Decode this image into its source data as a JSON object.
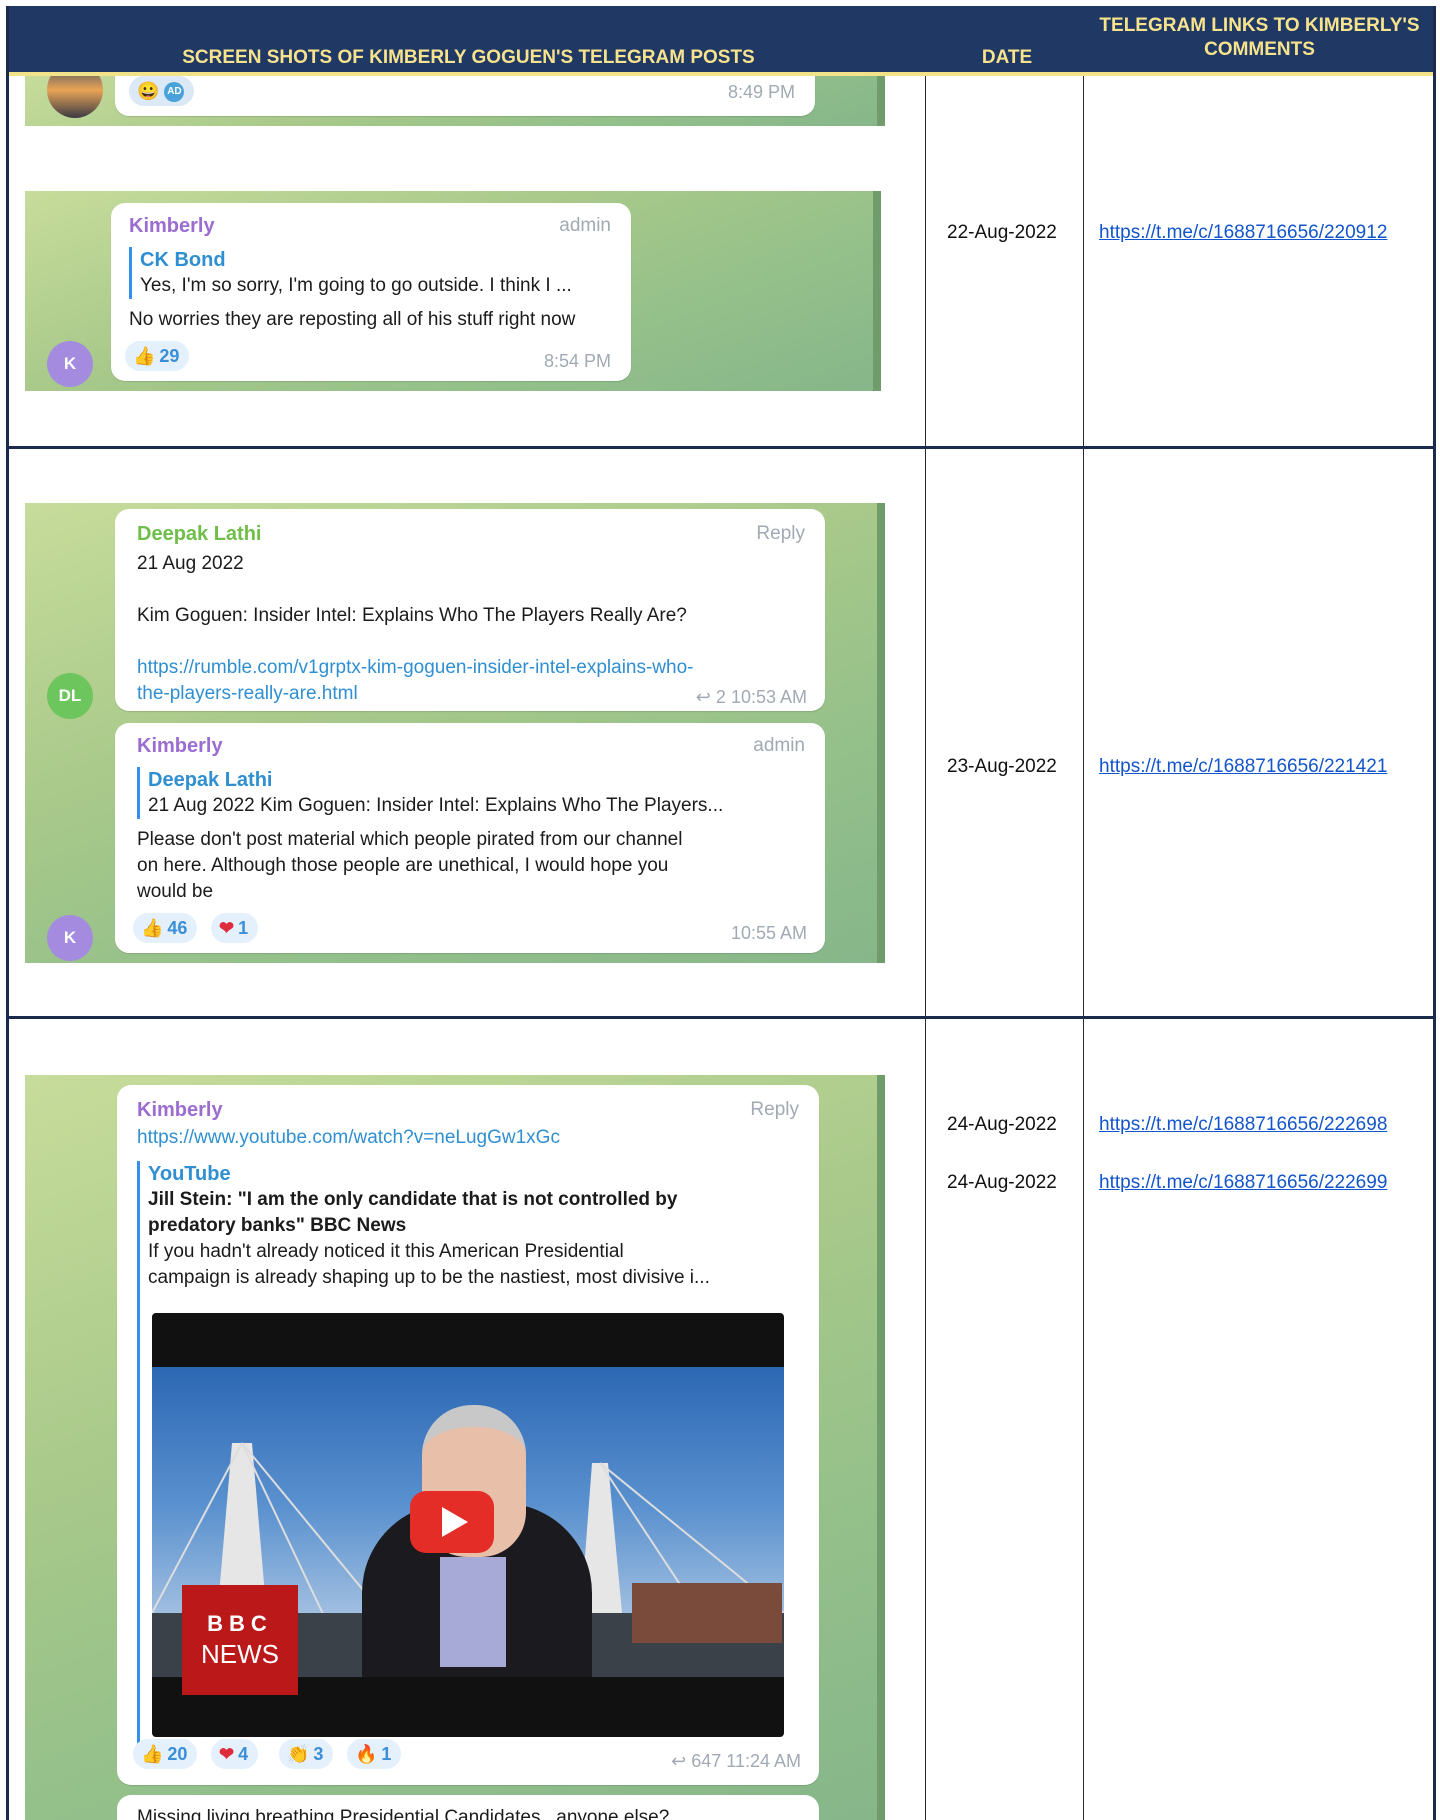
{
  "header": {
    "col1": "SCREEN SHOTS OF KIMBERLY GOGUEN'S TELEGRAM POSTS",
    "col2": "DATE",
    "col3": "TELEGRAM LINKS TO KIMBERLY'S COMMENTS"
  },
  "rows": [
    {
      "dates": [
        "22-Aug-2022"
      ],
      "links": [
        "https://t.me/c/1688716656/220912"
      ],
      "shot_top": {
        "time": "8:49 PM",
        "reaction_avatar": "AD"
      },
      "message": {
        "sender": "Kimberly",
        "role": "admin",
        "quote_name": "CK Bond",
        "quote_text": "Yes, I'm so sorry,  I'm going to go outside.  I think I ...",
        "text": "No worries they are reposting all of his stuff right now",
        "reaction_count": "29",
        "time": "8:54 PM",
        "avatar": "K"
      }
    },
    {
      "dates": [
        "23-Aug-2022"
      ],
      "links": [
        "https://t.me/c/1688716656/221421"
      ],
      "message1": {
        "sender": "Deepak Lathi",
        "role": "Reply",
        "line1": "21 Aug 2022",
        "line2": "Kim Goguen: Insider Intel: Explains Who The Players Really Are?",
        "url1": "https://rumble.com/v1grptx-kim-goguen-insider-intel-explains-who-",
        "url2": "the-players-really-are.html",
        "replies": "2",
        "time": "10:53 AM",
        "avatar": "DL"
      },
      "message2": {
        "sender": "Kimberly",
        "role": "admin",
        "quote_name": "Deepak Lathi",
        "quote_text": "21 Aug 2022  Kim Goguen: Insider Intel: Explains Who The Players...",
        "text1": "Please don't post material which people pirated from our channel",
        "text2": "on here. Although those people are unethical, I would hope you",
        "text3": "would be",
        "reaction_like": "46",
        "reaction_heart": "1",
        "time": "10:55 AM",
        "avatar": "K"
      }
    },
    {
      "dates": [
        "24-Aug-2022",
        "24-Aug-2022"
      ],
      "links": [
        "https://t.me/c/1688716656/222698",
        "https://t.me/c/1688716656/222699"
      ],
      "message": {
        "sender": "Kimberly",
        "role": "Reply",
        "url": "https://www.youtube.com/watch?v=neLugGw1xGc",
        "preview_site": "YouTube",
        "preview_title1": "Jill Stein: \"I am the only candidate that is not controlled by",
        "preview_title2": "predatory banks\" BBC News",
        "preview_desc1": "If you hadn't already noticed it this American Presidential",
        "preview_desc2": "campaign is already shaping up to be the nastiest, most divisive i...",
        "video_logo_top": "BBC",
        "video_logo_bottom": "NEWS",
        "reaction_like": "20",
        "reaction_heart": "4",
        "reaction_clap": "3",
        "reaction_fire": "1",
        "forwards": "647",
        "time": "11:24 AM"
      },
      "next_message": "Missing living breathing Presidential Candidates.. anyone else?"
    }
  ]
}
